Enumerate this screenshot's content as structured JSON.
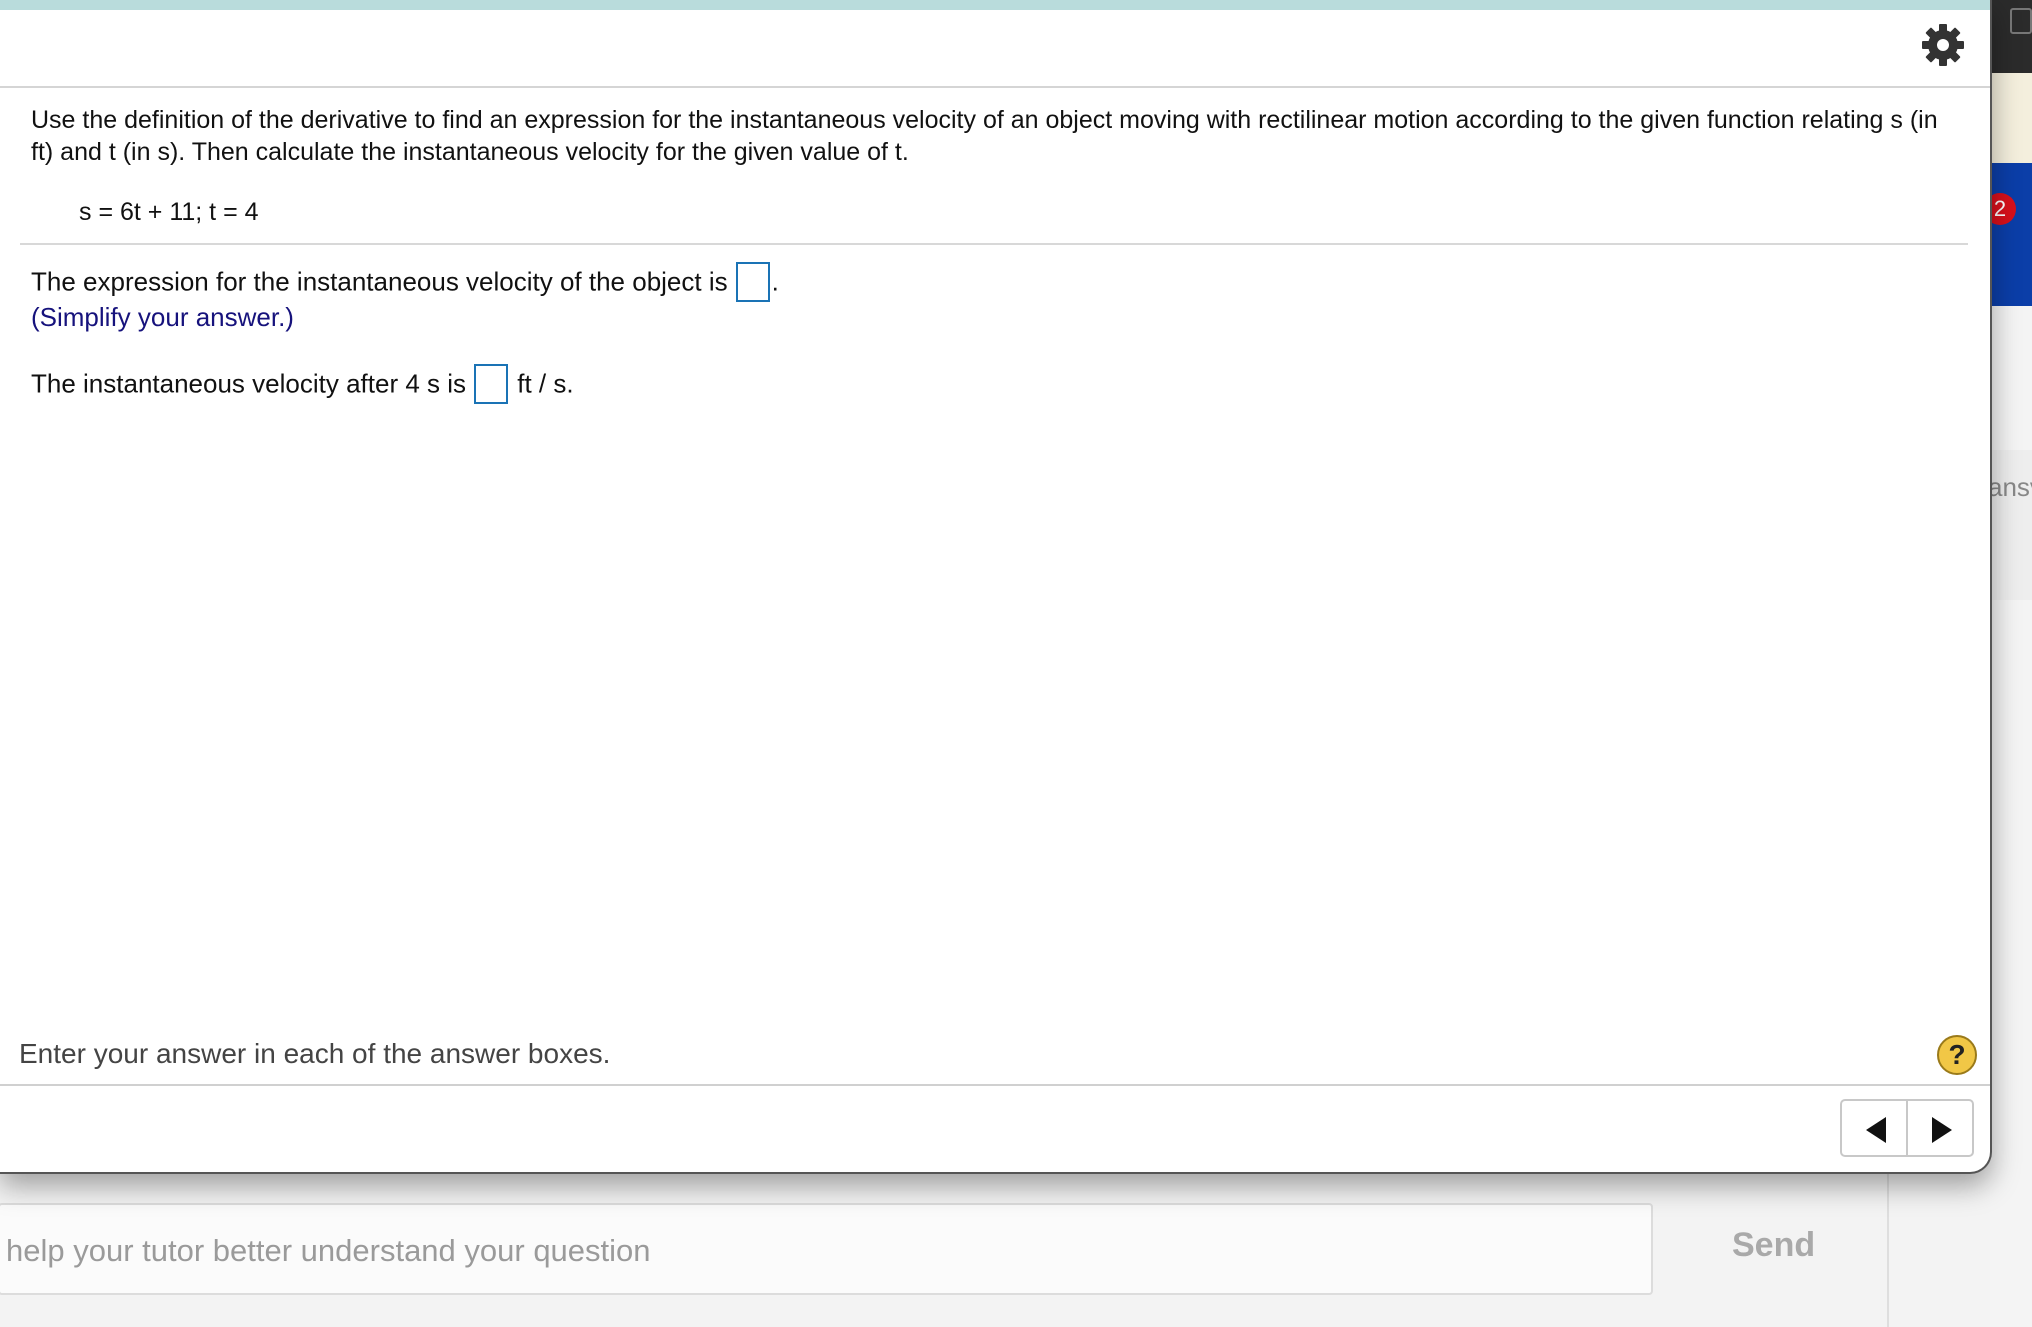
{
  "question": {
    "prompt": "Use the definition of the derivative to find an expression for the instantaneous velocity of an object moving with rectilinear motion according to the given function relating s (in ft) and t (in s). Then calculate the instantaneous velocity for the given value of t.",
    "equation": "s = 6t + 11; t = 4"
  },
  "answers": {
    "part1_text": "The expression for the instantaneous velocity of the object is",
    "part1_suffix": ".",
    "part1_value": "",
    "hint": "(Simplify your answer.)",
    "part2_text": "The instantaneous velocity after 4 s is",
    "part2_value": "",
    "part2_unit": "ft / s."
  },
  "footer": {
    "instruction": "Enter your answer in each of the answer boxes.",
    "help_label": "?"
  },
  "chat": {
    "input_placeholder": "help your tutor better understand your question",
    "send_label": "Send"
  },
  "background": {
    "badge": "2",
    "partial_text": "ansv"
  },
  "icons": {
    "gear": "gear-icon",
    "help": "question-mark-icon",
    "prev": "triangle-left-icon",
    "next": "triangle-right-icon"
  }
}
